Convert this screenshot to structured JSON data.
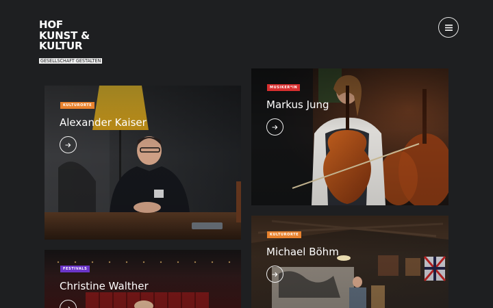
{
  "logo": {
    "line1": "HOF",
    "line2": "KUNST &",
    "line3": "KULTUR",
    "tagline": "GESELLSCHAFT GESTALTEN"
  },
  "menu": {
    "icon": "hamburger-menu-icon"
  },
  "cards": [
    {
      "category": "KULTURORTE",
      "category_color": "#e8822e",
      "name": "Alexander Kaiser",
      "arrow_icon": "arrow-right-icon"
    },
    {
      "category": "MUSIKER*IN",
      "category_color": "#d82f2f",
      "name": "Markus Jung",
      "arrow_icon": "arrow-right-icon"
    },
    {
      "category": "KULTURORTE",
      "category_color": "#e8822e",
      "name": "Michael Böhm",
      "arrow_icon": "arrow-right-icon"
    },
    {
      "category": "FESTIVALS",
      "category_color": "#6b35c9",
      "name": "Christine Walther",
      "arrow_icon": "arrow-right-icon"
    }
  ]
}
